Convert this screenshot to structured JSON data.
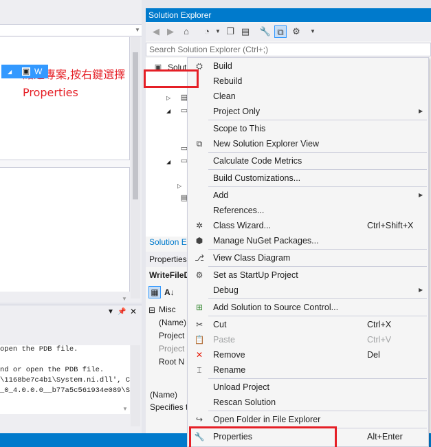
{
  "annotation": "點選專案,按右鍵選擇Properties",
  "editor": {},
  "output": {
    "lines": [
      "open the PDB file.",
      "",
      "nd or open the PDB file.",
      "\\1168be7c4b1\\System.ni.dll', Can",
      "_0_4.0.0.0__b77a5c561934e089\\Sy"
    ]
  },
  "solution_explorer": {
    "title": "Solution Explorer",
    "search_placeholder": "Search Solution Explorer (Ctrl+;)",
    "tree": {
      "solution_label": "Solut",
      "project_label": "W"
    },
    "tab_label": "Solution E"
  },
  "properties": {
    "title": "Properties",
    "object": "WriteFileD",
    "category": "Misc",
    "rows": [
      "(Name)",
      "Project",
      "Project",
      "Root N"
    ],
    "desc_title": "(Name)",
    "desc_text": "Specifies t"
  },
  "context_menu": {
    "items": [
      {
        "label": "Build",
        "icon": "build-icon"
      },
      {
        "label": "Rebuild",
        "icon": ""
      },
      {
        "label": "Clean",
        "icon": ""
      },
      {
        "label": "Project Only",
        "icon": "",
        "submenu": true
      },
      {
        "label": "Scope to This",
        "icon": ""
      },
      {
        "label": "New Solution Explorer View",
        "icon": "new-view-icon"
      },
      {
        "label": "Calculate Code Metrics",
        "icon": ""
      },
      {
        "label": "Build Customizations...",
        "icon": ""
      },
      {
        "label": "Add",
        "icon": "",
        "submenu": true
      },
      {
        "label": "References...",
        "icon": ""
      },
      {
        "label": "Class Wizard...",
        "icon": "class-wizard-icon",
        "shortcut": "Ctrl+Shift+X"
      },
      {
        "label": "Manage NuGet Packages...",
        "icon": "nuget-icon"
      },
      {
        "label": "View Class Diagram",
        "icon": "class-diagram-icon"
      },
      {
        "label": "Set as StartUp Project",
        "icon": "gear-icon"
      },
      {
        "label": "Debug",
        "icon": "",
        "submenu": true
      },
      {
        "label": "Add Solution to Source Control...",
        "icon": "source-control-icon"
      },
      {
        "label": "Cut",
        "icon": "scissors-icon",
        "shortcut": "Ctrl+X"
      },
      {
        "label": "Paste",
        "icon": "paste-icon",
        "shortcut": "Ctrl+V",
        "disabled": true
      },
      {
        "label": "Remove",
        "icon": "remove-icon",
        "shortcut": "Del"
      },
      {
        "label": "Rename",
        "icon": "rename-icon"
      },
      {
        "label": "Unload Project",
        "icon": ""
      },
      {
        "label": "Rescan Solution",
        "icon": ""
      },
      {
        "label": "Open Folder in File Explorer",
        "icon": "open-folder-icon"
      },
      {
        "label": "Properties",
        "icon": "wrench-icon",
        "shortcut": "Alt+Enter"
      }
    ]
  },
  "colors": {
    "accent": "#007acc",
    "highlight": "#e51f26",
    "selection": "#3399ff"
  }
}
